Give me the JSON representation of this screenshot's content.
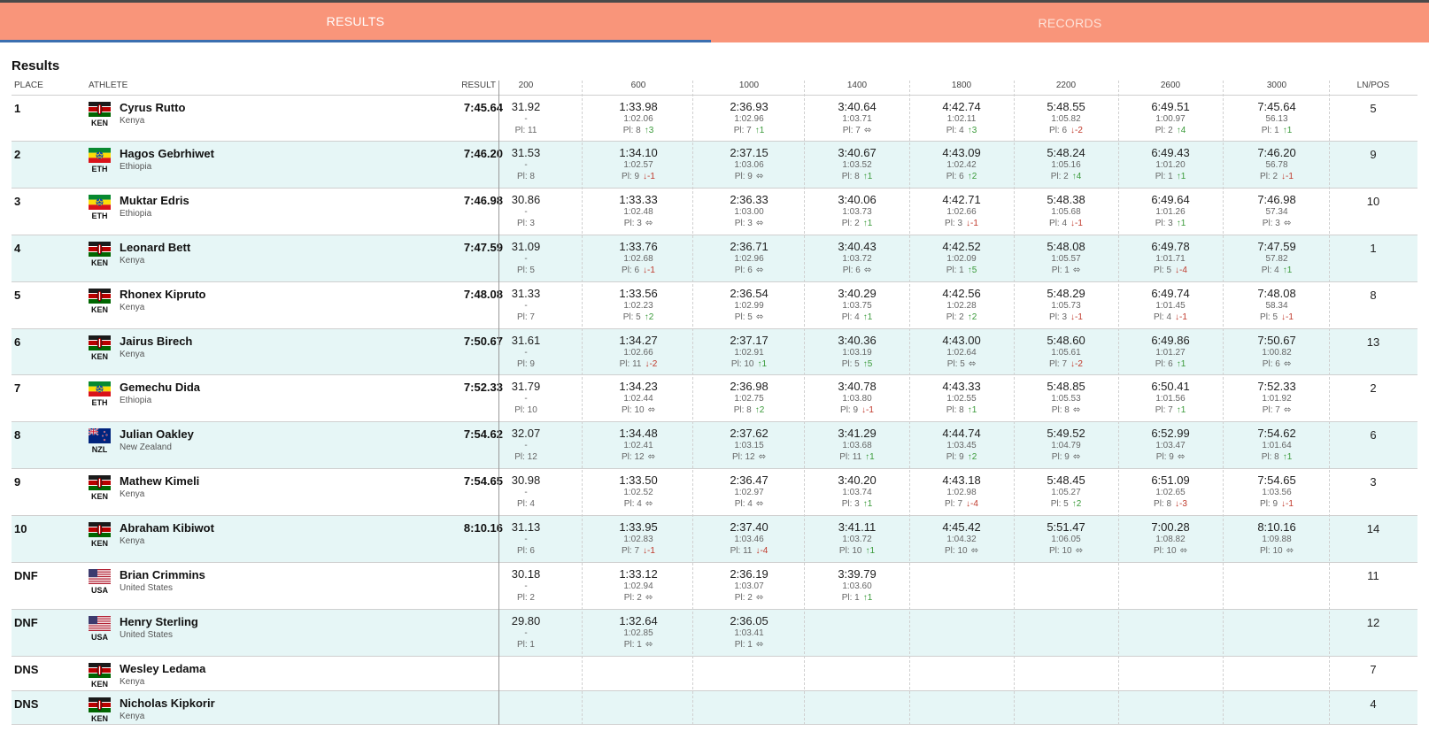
{
  "tabs": [
    {
      "label": "RESULTS",
      "active": true
    },
    {
      "label": "RECORDS",
      "active": false
    }
  ],
  "section_title": "Results",
  "columns": {
    "place": "PLACE",
    "athlete": "ATHLETE",
    "result": "RESULT",
    "splits": [
      "200",
      "600",
      "1000",
      "1400",
      "1800",
      "2200",
      "2600",
      "3000"
    ],
    "lnpos": "LN/POS"
  },
  "colors": {
    "tab_bar": "#f9957a",
    "tab_active_underline": "#3b6fb0",
    "row_alt": "#e6f6f6",
    "up": "#3a9a3a",
    "down": "#c0392b"
  },
  "rows": [
    {
      "place": "1",
      "flag": "kenya-flag",
      "code": "KEN",
      "name": "Cyrus Rutto",
      "country": "Kenya",
      "result": "7:45.64",
      "lnpos": "5",
      "splits": [
        [
          "31.92",
          "-",
          "Pl: 11",
          ""
        ],
        [
          "1:33.98",
          "1:02.06",
          "Pl: 8",
          "↑3"
        ],
        [
          "2:36.93",
          "1:02.96",
          "Pl: 7",
          "↑1"
        ],
        [
          "3:40.64",
          "1:03.71",
          "Pl: 7",
          "⬄"
        ],
        [
          "4:42.74",
          "1:02.11",
          "Pl: 4",
          "↑3"
        ],
        [
          "5:48.55",
          "1:05.82",
          "Pl: 6",
          "↓-2"
        ],
        [
          "6:49.51",
          "1:00.97",
          "Pl: 2",
          "↑4"
        ],
        [
          "7:45.64",
          "56.13",
          "Pl: 1",
          "↑1"
        ]
      ]
    },
    {
      "place": "2",
      "flag": "ethiopia-flag",
      "code": "ETH",
      "name": "Hagos Gebrhiwet",
      "country": "Ethiopia",
      "result": "7:46.20",
      "lnpos": "9",
      "splits": [
        [
          "31.53",
          "-",
          "Pl: 8",
          ""
        ],
        [
          "1:34.10",
          "1:02.57",
          "Pl: 9",
          "↓-1"
        ],
        [
          "2:37.15",
          "1:03.06",
          "Pl: 9",
          "⬄"
        ],
        [
          "3:40.67",
          "1:03.52",
          "Pl: 8",
          "↑1"
        ],
        [
          "4:43.09",
          "1:02.42",
          "Pl: 6",
          "↑2"
        ],
        [
          "5:48.24",
          "1:05.16",
          "Pl: 2",
          "↑4"
        ],
        [
          "6:49.43",
          "1:01.20",
          "Pl: 1",
          "↑1"
        ],
        [
          "7:46.20",
          "56.78",
          "Pl: 2",
          "↓-1"
        ]
      ]
    },
    {
      "place": "3",
      "flag": "ethiopia-flag",
      "code": "ETH",
      "name": "Muktar Edris",
      "country": "Ethiopia",
      "result": "7:46.98",
      "lnpos": "10",
      "splits": [
        [
          "30.86",
          "-",
          "Pl: 3",
          ""
        ],
        [
          "1:33.33",
          "1:02.48",
          "Pl: 3",
          "⬄"
        ],
        [
          "2:36.33",
          "1:03.00",
          "Pl: 3",
          "⬄"
        ],
        [
          "3:40.06",
          "1:03.73",
          "Pl: 2",
          "↑1"
        ],
        [
          "4:42.71",
          "1:02.66",
          "Pl: 3",
          "↓-1"
        ],
        [
          "5:48.38",
          "1:05.68",
          "Pl: 4",
          "↓-1"
        ],
        [
          "6:49.64",
          "1:01.26",
          "Pl: 3",
          "↑1"
        ],
        [
          "7:46.98",
          "57.34",
          "Pl: 3",
          "⬄"
        ]
      ]
    },
    {
      "place": "4",
      "flag": "kenya-flag",
      "code": "KEN",
      "name": "Leonard Bett",
      "country": "Kenya",
      "result": "7:47.59",
      "lnpos": "1",
      "splits": [
        [
          "31.09",
          "-",
          "Pl: 5",
          ""
        ],
        [
          "1:33.76",
          "1:02.68",
          "Pl: 6",
          "↓-1"
        ],
        [
          "2:36.71",
          "1:02.96",
          "Pl: 6",
          "⬄"
        ],
        [
          "3:40.43",
          "1:03.72",
          "Pl: 6",
          "⬄"
        ],
        [
          "4:42.52",
          "1:02.09",
          "Pl: 1",
          "↑5"
        ],
        [
          "5:48.08",
          "1:05.57",
          "Pl: 1",
          "⬄"
        ],
        [
          "6:49.78",
          "1:01.71",
          "Pl: 5",
          "↓-4"
        ],
        [
          "7:47.59",
          "57.82",
          "Pl: 4",
          "↑1"
        ]
      ]
    },
    {
      "place": "5",
      "flag": "kenya-flag",
      "code": "KEN",
      "name": "Rhonex Kipruto",
      "country": "Kenya",
      "result": "7:48.08",
      "lnpos": "8",
      "splits": [
        [
          "31.33",
          "-",
          "Pl: 7",
          ""
        ],
        [
          "1:33.56",
          "1:02.23",
          "Pl: 5",
          "↑2"
        ],
        [
          "2:36.54",
          "1:02.99",
          "Pl: 5",
          "⬄"
        ],
        [
          "3:40.29",
          "1:03.75",
          "Pl: 4",
          "↑1"
        ],
        [
          "4:42.56",
          "1:02.28",
          "Pl: 2",
          "↑2"
        ],
        [
          "5:48.29",
          "1:05.73",
          "Pl: 3",
          "↓-1"
        ],
        [
          "6:49.74",
          "1:01.45",
          "Pl: 4",
          "↓-1"
        ],
        [
          "7:48.08",
          "58.34",
          "Pl: 5",
          "↓-1"
        ]
      ]
    },
    {
      "place": "6",
      "flag": "kenya-flag",
      "code": "KEN",
      "name": "Jairus Birech",
      "country": "Kenya",
      "result": "7:50.67",
      "lnpos": "13",
      "splits": [
        [
          "31.61",
          "-",
          "Pl: 9",
          ""
        ],
        [
          "1:34.27",
          "1:02.66",
          "Pl: 11",
          "↓-2"
        ],
        [
          "2:37.17",
          "1:02.91",
          "Pl: 10",
          "↑1"
        ],
        [
          "3:40.36",
          "1:03.19",
          "Pl: 5",
          "↑5"
        ],
        [
          "4:43.00",
          "1:02.64",
          "Pl: 5",
          "⬄"
        ],
        [
          "5:48.60",
          "1:05.61",
          "Pl: 7",
          "↓-2"
        ],
        [
          "6:49.86",
          "1:01.27",
          "Pl: 6",
          "↑1"
        ],
        [
          "7:50.67",
          "1:00.82",
          "Pl: 6",
          "⬄"
        ]
      ]
    },
    {
      "place": "7",
      "flag": "ethiopia-flag",
      "code": "ETH",
      "name": "Gemechu Dida",
      "country": "Ethiopia",
      "result": "7:52.33",
      "lnpos": "2",
      "splits": [
        [
          "31.79",
          "-",
          "Pl: 10",
          ""
        ],
        [
          "1:34.23",
          "1:02.44",
          "Pl: 10",
          "⬄"
        ],
        [
          "2:36.98",
          "1:02.75",
          "Pl: 8",
          "↑2"
        ],
        [
          "3:40.78",
          "1:03.80",
          "Pl: 9",
          "↓-1"
        ],
        [
          "4:43.33",
          "1:02.55",
          "Pl: 8",
          "↑1"
        ],
        [
          "5:48.85",
          "1:05.53",
          "Pl: 8",
          "⬄"
        ],
        [
          "6:50.41",
          "1:01.56",
          "Pl: 7",
          "↑1"
        ],
        [
          "7:52.33",
          "1:01.92",
          "Pl: 7",
          "⬄"
        ]
      ]
    },
    {
      "place": "8",
      "flag": "new-zealand-flag",
      "code": "NZL",
      "name": "Julian Oakley",
      "country": "New Zealand",
      "result": "7:54.62",
      "lnpos": "6",
      "splits": [
        [
          "32.07",
          "-",
          "Pl: 12",
          ""
        ],
        [
          "1:34.48",
          "1:02.41",
          "Pl: 12",
          "⬄"
        ],
        [
          "2:37.62",
          "1:03.15",
          "Pl: 12",
          "⬄"
        ],
        [
          "3:41.29",
          "1:03.68",
          "Pl: 11",
          "↑1"
        ],
        [
          "4:44.74",
          "1:03.45",
          "Pl: 9",
          "↑2"
        ],
        [
          "5:49.52",
          "1:04.79",
          "Pl: 9",
          "⬄"
        ],
        [
          "6:52.99",
          "1:03.47",
          "Pl: 9",
          "⬄"
        ],
        [
          "7:54.62",
          "1:01.64",
          "Pl: 8",
          "↑1"
        ]
      ]
    },
    {
      "place": "9",
      "flag": "kenya-flag",
      "code": "KEN",
      "name": "Mathew Kimeli",
      "country": "Kenya",
      "result": "7:54.65",
      "lnpos": "3",
      "splits": [
        [
          "30.98",
          "-",
          "Pl: 4",
          ""
        ],
        [
          "1:33.50",
          "1:02.52",
          "Pl: 4",
          "⬄"
        ],
        [
          "2:36.47",
          "1:02.97",
          "Pl: 4",
          "⬄"
        ],
        [
          "3:40.20",
          "1:03.74",
          "Pl: 3",
          "↑1"
        ],
        [
          "4:43.18",
          "1:02.98",
          "Pl: 7",
          "↓-4"
        ],
        [
          "5:48.45",
          "1:05.27",
          "Pl: 5",
          "↑2"
        ],
        [
          "6:51.09",
          "1:02.65",
          "Pl: 8",
          "↓-3"
        ],
        [
          "7:54.65",
          "1:03.56",
          "Pl: 9",
          "↓-1"
        ]
      ]
    },
    {
      "place": "10",
      "flag": "kenya-flag",
      "code": "KEN",
      "name": "Abraham Kibiwot",
      "country": "Kenya",
      "result": "8:10.16",
      "lnpos": "14",
      "splits": [
        [
          "31.13",
          "-",
          "Pl: 6",
          ""
        ],
        [
          "1:33.95",
          "1:02.83",
          "Pl: 7",
          "↓-1"
        ],
        [
          "2:37.40",
          "1:03.46",
          "Pl: 11",
          "↓-4"
        ],
        [
          "3:41.11",
          "1:03.72",
          "Pl: 10",
          "↑1"
        ],
        [
          "4:45.42",
          "1:04.32",
          "Pl: 10",
          "⬄"
        ],
        [
          "5:51.47",
          "1:06.05",
          "Pl: 10",
          "⬄"
        ],
        [
          "7:00.28",
          "1:08.82",
          "Pl: 10",
          "⬄"
        ],
        [
          "8:10.16",
          "1:09.88",
          "Pl: 10",
          "⬄"
        ]
      ]
    },
    {
      "place": "DNF",
      "flag": "usa-flag",
      "code": "USA",
      "name": "Brian Crimmins",
      "country": "United States",
      "result": "",
      "lnpos": "11",
      "splits": [
        [
          "30.18",
          "-",
          "Pl: 2",
          ""
        ],
        [
          "1:33.12",
          "1:02.94",
          "Pl: 2",
          "⬄"
        ],
        [
          "2:36.19",
          "1:03.07",
          "Pl: 2",
          "⬄"
        ],
        [
          "3:39.79",
          "1:03.60",
          "Pl: 1",
          "↑1"
        ]
      ]
    },
    {
      "place": "DNF",
      "flag": "usa-flag",
      "code": "USA",
      "name": "Henry Sterling",
      "country": "United States",
      "result": "",
      "lnpos": "12",
      "splits": [
        [
          "29.80",
          "-",
          "Pl: 1",
          ""
        ],
        [
          "1:32.64",
          "1:02.85",
          "Pl: 1",
          "⬄"
        ],
        [
          "2:36.05",
          "1:03.41",
          "Pl: 1",
          "⬄"
        ]
      ]
    },
    {
      "place": "DNS",
      "flag": "kenya-flag",
      "code": "KEN",
      "name": "Wesley Ledama",
      "country": "Kenya",
      "result": "",
      "lnpos": "7",
      "splits": []
    },
    {
      "place": "DNS",
      "flag": "kenya-flag",
      "code": "KEN",
      "name": "Nicholas Kipkorir",
      "country": "Kenya",
      "result": "",
      "lnpos": "4",
      "splits": []
    }
  ]
}
